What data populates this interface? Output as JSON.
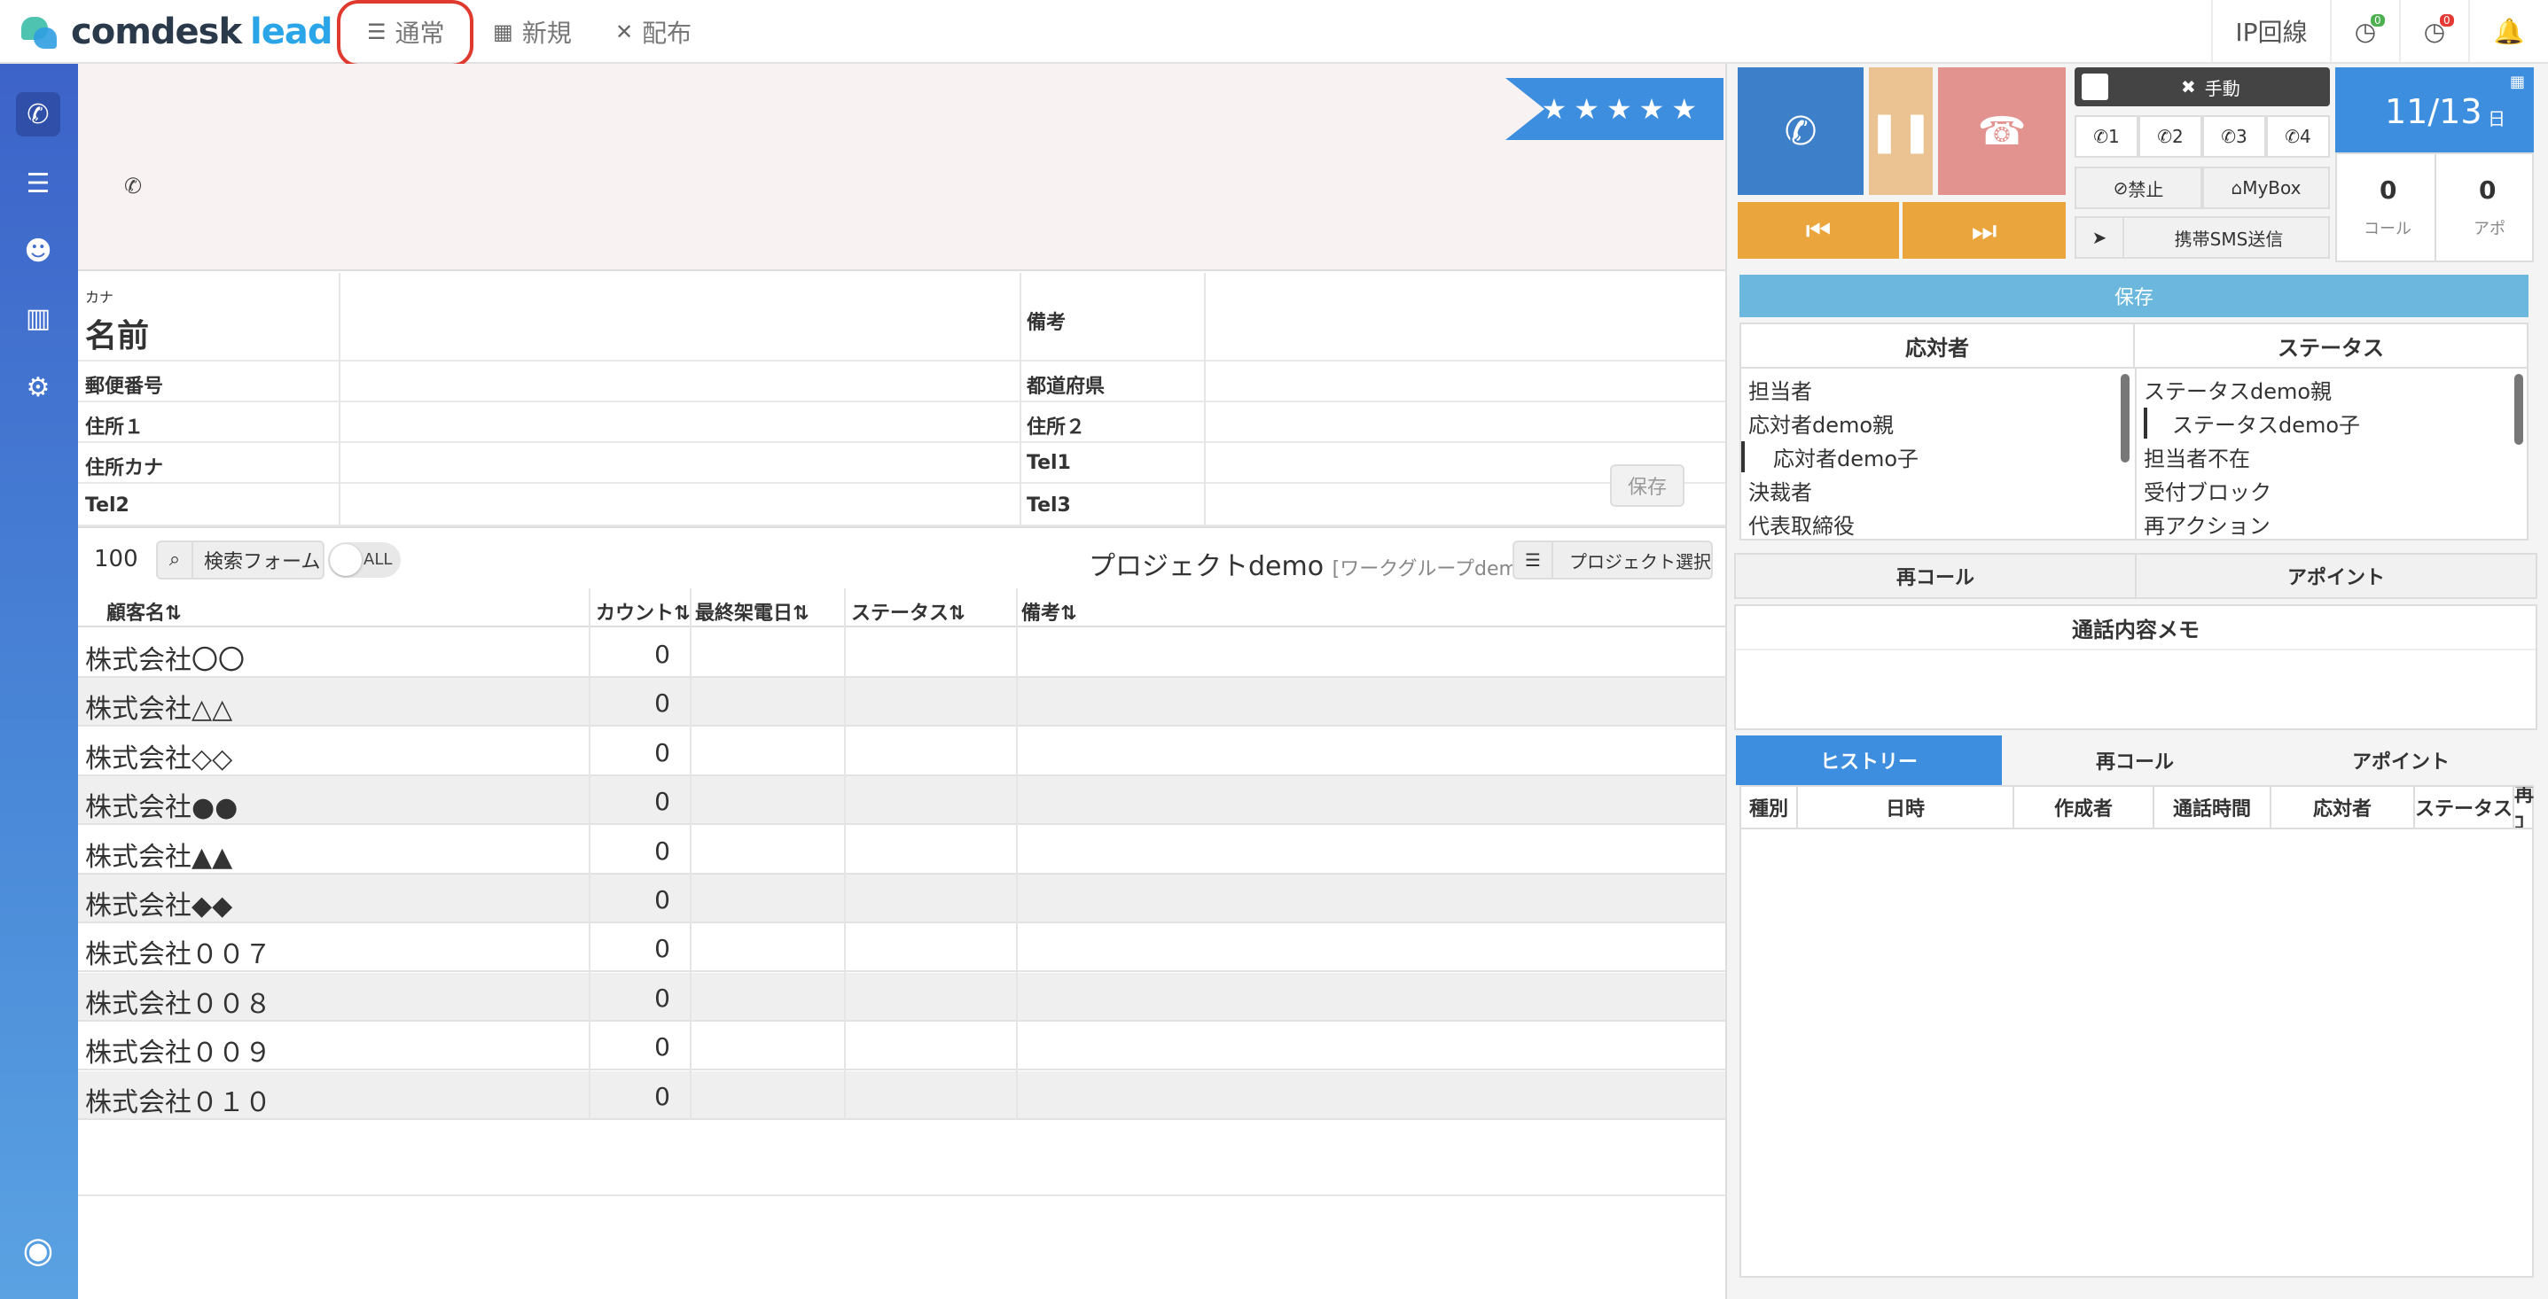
{
  "app": {
    "logo_main": "comdesk",
    "logo_sub": "lead"
  },
  "nav": {
    "tabs": [
      {
        "label": "通常",
        "icon": "list-icon"
      },
      {
        "label": "新規",
        "icon": "grid-icon"
      },
      {
        "label": "配布",
        "icon": "arrows-icon"
      }
    ]
  },
  "topright": {
    "ip_line": "IP回線",
    "badge1": "0",
    "badge2": "0"
  },
  "rating": "★★★★★",
  "detail": {
    "kana": "カナ",
    "name": "名前",
    "bikou": "備考",
    "postal": "郵便番号",
    "prefecture": "都道府県",
    "address1": "住所１",
    "address2": "住所２",
    "address_kana": "住所カナ",
    "tel1": "Tel1",
    "tel2": "Tel2",
    "tel3": "Tel3",
    "save": "保存"
  },
  "list": {
    "count": "100",
    "search_label": "検索フォーム",
    "all_label": "ALL",
    "project_name": "プロジェクトdemo",
    "workgroup": "[ワークグループdemo]",
    "project_select": "プロジェクト選択",
    "headers": [
      "顧客名⇅",
      "カウント⇅",
      "最終架電日⇅",
      "ステータス⇅",
      "備考⇅"
    ],
    "rows": [
      {
        "name": "株式会社〇〇",
        "count": "0"
      },
      {
        "name": "株式会社△△",
        "count": "0"
      },
      {
        "name": "株式会社◇◇",
        "count": "0"
      },
      {
        "name": "株式会社●●",
        "count": "0"
      },
      {
        "name": "株式会社▲▲",
        "count": "0"
      },
      {
        "name": "株式会社◆◆",
        "count": "0"
      },
      {
        "name": "株式会社００７",
        "count": "0"
      },
      {
        "name": "株式会社００８",
        "count": "0"
      },
      {
        "name": "株式会社００９",
        "count": "0"
      },
      {
        "name": "株式会社０１０",
        "count": "0"
      }
    ]
  },
  "call": {
    "manual_label": "手動",
    "lines": [
      "1",
      "2",
      "3",
      "4"
    ],
    "ban": "禁止",
    "mybox": "MyBox",
    "sms": "携帯SMS送信",
    "date": "11/13",
    "date_suffix": "日",
    "stat_call_value": "0",
    "stat_call_label": "コール",
    "stat_apo_value": "0",
    "stat_apo_label": "アポ",
    "save": "保存"
  },
  "responders": {
    "title": "応対者",
    "items": [
      "担当者",
      "応対者demo親",
      "応対者demo子",
      "決裁者",
      "代表取締役"
    ]
  },
  "statuses": {
    "title": "ステータス",
    "items": [
      "ステータスdemo親",
      "ステータスdemo子",
      "担当者不在",
      "受付ブロック",
      "再アクション"
    ]
  },
  "actions": {
    "recall": "再コール",
    "appoint": "アポイント"
  },
  "memo_title": "通話内容メモ",
  "history": {
    "tabs": [
      "ヒストリー",
      "再コール",
      "アポイント"
    ],
    "headers": [
      "種別",
      "日時",
      "作成者",
      "通話時間",
      "応対者",
      "ステータス",
      "再ｺ"
    ]
  },
  "colors": {
    "accent": "#3e8ee0",
    "call_green": "#3e7fc9",
    "pause": "#ebc392",
    "hangup": "#e2938f",
    "skip": "#eaa53c"
  }
}
